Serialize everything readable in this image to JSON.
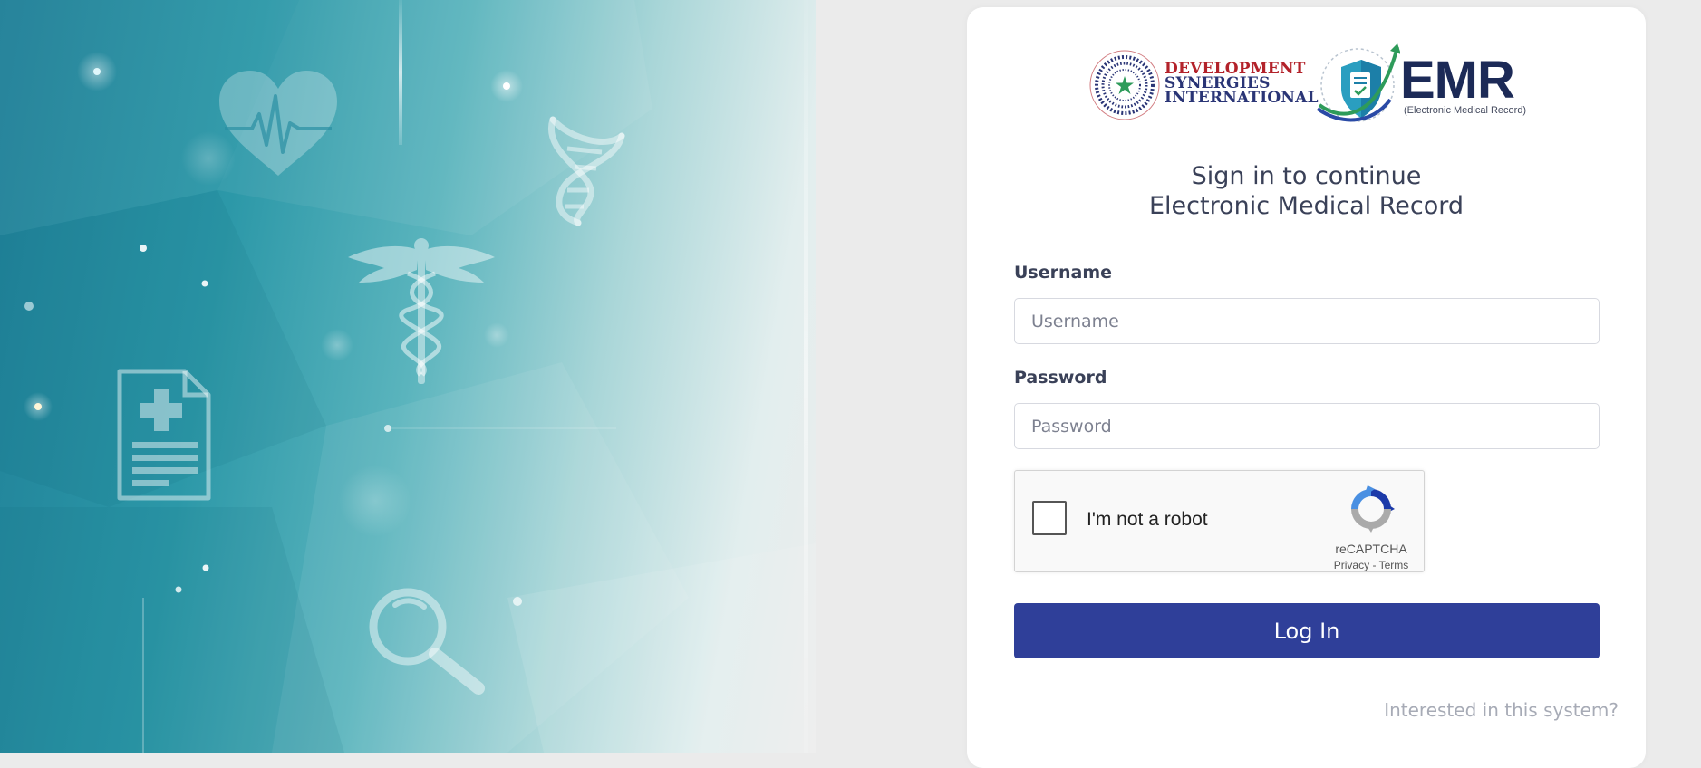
{
  "hero": {
    "icons": [
      "heart-pulse-icon",
      "dna-icon",
      "caduceus-icon",
      "medical-document-icon",
      "magnifier-icon"
    ]
  },
  "logos": {
    "dsi_lines": [
      "DEVELOPMENT",
      "SYNERGIES",
      "INTERNATIONAL"
    ],
    "emr_word": "EMR",
    "emr_sub": "(Electronic Medical Record)"
  },
  "title": {
    "line1": "Sign in to continue",
    "line2": "Electronic Medical Record"
  },
  "form": {
    "username_label": "Username",
    "username_placeholder": "Username",
    "username_value": "",
    "password_label": "Password",
    "password_placeholder": "Password",
    "password_value": ""
  },
  "captcha": {
    "label": "I'm not a robot",
    "brand": "reCAPTCHA",
    "privacy": "Privacy",
    "separator": " - ",
    "terms": "Terms",
    "checked": false
  },
  "login_button": "Log In",
  "interest_link": "Interested in this system?",
  "colors": {
    "primary": "#2f3f99",
    "hero_teal": "#2c98a8",
    "dsi_red": "#b3222a",
    "dsi_navy": "#2a3576",
    "emr_navy": "#1c2a57"
  }
}
